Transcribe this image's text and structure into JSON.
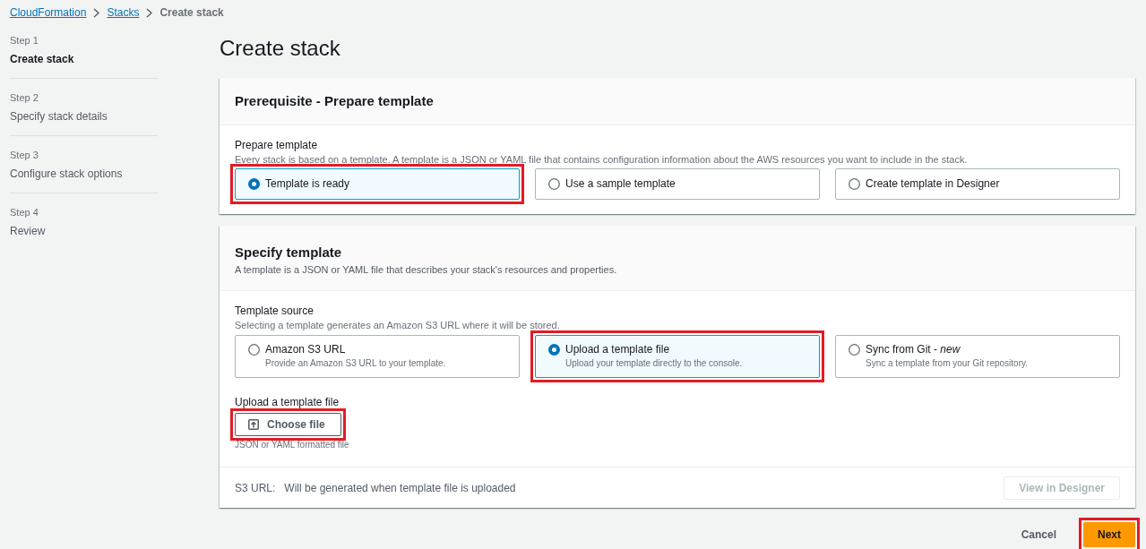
{
  "breadcrumbs": [
    {
      "label": "CloudFormation",
      "kind": "link"
    },
    {
      "label": "Stacks",
      "kind": "link"
    },
    {
      "label": "Create stack",
      "kind": "current"
    }
  ],
  "steps": [
    {
      "step": "Step 1",
      "title": "Create stack",
      "selected": true
    },
    {
      "step": "Step 2",
      "title": "Specify stack details",
      "selected": false
    },
    {
      "step": "Step 3",
      "title": "Configure stack options",
      "selected": false
    },
    {
      "step": "Step 4",
      "title": "Review",
      "selected": false
    }
  ],
  "page_title": "Create stack",
  "prerequisite": {
    "title": "Prerequisite - Prepare template",
    "field": {
      "label": "Prepare template",
      "description": "Every stack is based on a template. A template is a JSON or YAML file that contains configuration information about the AWS resources you want to include in the stack.",
      "options": [
        {
          "label": "Template is ready",
          "selected": true,
          "highlighted": true
        },
        {
          "label": "Use a sample template",
          "selected": false,
          "highlighted": false
        },
        {
          "label": "Create template in Designer",
          "selected": false,
          "highlighted": false
        }
      ]
    }
  },
  "specify_template": {
    "title": "Specify template",
    "description": "A template is a JSON or YAML file that describes your stack's resources and properties.",
    "source": {
      "label": "Template source",
      "description": "Selecting a template generates an Amazon S3 URL where it will be stored.",
      "options": [
        {
          "label": "Amazon S3 URL",
          "description": "Provide an Amazon S3 URL to your template.",
          "selected": false,
          "highlighted": false
        },
        {
          "label": "Upload a template file",
          "description": "Upload your template directly to the console.",
          "selected": true,
          "highlighted": true
        },
        {
          "label": "Sync from Git - *new*",
          "description": "Sync a template from your Git repository.",
          "selected": false,
          "highlighted": false
        }
      ]
    },
    "upload": {
      "label": "Upload a template file",
      "button": {
        "label": "Choose file",
        "highlighted": true
      },
      "hint": "JSON or YAML formatted file"
    },
    "s3_url": {
      "label": "S3 URL:",
      "value": "Will be generated when template file is uploaded"
    },
    "view_button": {
      "label": "View in Designer",
      "disabled": true
    }
  },
  "footer": {
    "buttons": [
      {
        "label": "Cancel",
        "kind": "link",
        "highlighted": false
      },
      {
        "label": "Next",
        "kind": "primary",
        "highlighted": true
      }
    ]
  }
}
